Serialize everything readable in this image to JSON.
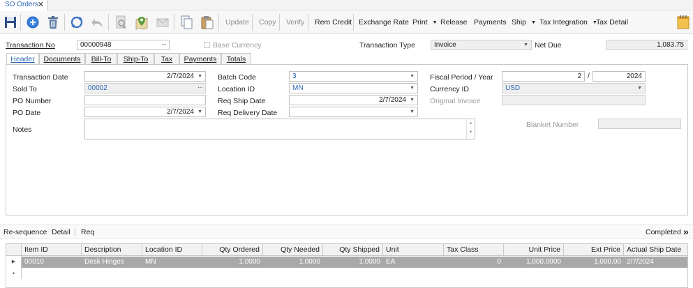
{
  "window_tab": {
    "title": "SO Orders",
    "close": "✕"
  },
  "toolbar": {
    "update": "Update",
    "copy": "Copy",
    "verify": "Verify",
    "rem_credit": "Rem Credit",
    "exchange_rate": "Exchange Rate",
    "print": "Print",
    "release": "Release",
    "payments": "Payments",
    "ship": "Ship",
    "tax_integration": "Tax Integration",
    "tax_detail": "Tax Detail"
  },
  "top_fields": {
    "transaction_no_label": "Transaction No",
    "transaction_no": "00000948",
    "base_currency_label": "Base Currency",
    "transaction_type_label": "Transaction Type",
    "transaction_type": "Invoice",
    "net_due_label": "Net Due",
    "net_due": "1,083.75"
  },
  "tabs": [
    "Header",
    "Documents",
    "Bill-To",
    "Ship-To",
    "Tax",
    "Payments",
    "Totals"
  ],
  "header": {
    "transaction_date_label": "Transaction Date",
    "transaction_date": "2/7/2024",
    "sold_to_label": "Sold To",
    "sold_to": "00002",
    "po_number_label": "PO Number",
    "po_number": "",
    "po_date_label": "PO Date",
    "po_date": "2/7/2024",
    "notes_label": "Notes",
    "batch_code_label": "Batch Code",
    "batch_code": "3",
    "location_id_label": "Location ID",
    "location_id": "MN",
    "req_ship_date_label": "Req Ship Date",
    "req_ship_date": "2/7/2024",
    "req_delivery_date_label": "Req Delivery Date",
    "req_delivery_date": "",
    "fiscal_period_year_label": "Fiscal Period / Year",
    "fiscal_period": "2",
    "fiscal_sep": "/",
    "fiscal_year": "2024",
    "currency_id_label": "Currency ID",
    "currency_id": "USD",
    "original_invoice_label": "Original Invoice",
    "original_invoice": "",
    "blanket_number_label": "Blanket Number",
    "blanket_number": ""
  },
  "subbar": {
    "resequence": "Re-sequence",
    "detail": "Detail",
    "req": "Req",
    "status": "Completed",
    "expand": "»"
  },
  "grid": {
    "columns": [
      "Item ID",
      "Description",
      "Location ID",
      "Qty Ordered",
      "Qty Needed",
      "Qty Shipped",
      "Unit",
      "Tax Class",
      "Unit Price",
      "Ext Price",
      "Actual Ship Date"
    ],
    "rows": [
      {
        "item_id": "00010",
        "description": "Desk Hinges",
        "location_id": "MN",
        "qty_ordered": "1.0000",
        "qty_needed": "1.0000",
        "qty_shipped": "1.0000",
        "unit": "EA",
        "tax_class": "0",
        "unit_price": "1,000.0000",
        "ext_price": "1,000.00",
        "actual_ship_date": "2/7/2024"
      }
    ]
  }
}
